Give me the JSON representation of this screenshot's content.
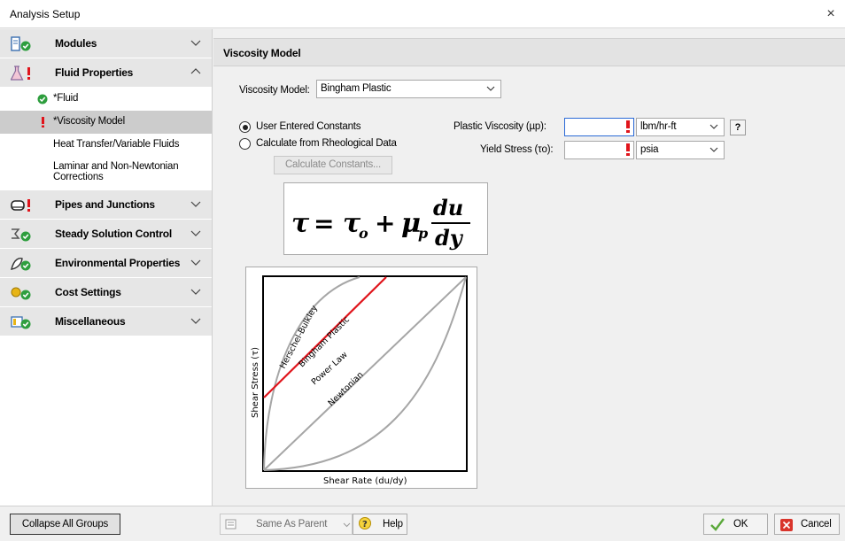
{
  "window": {
    "title": "Analysis Setup",
    "close_glyph": "×"
  },
  "sidebar": {
    "groups": [
      {
        "label": "Modules",
        "icon": "modules-icon",
        "status": "ok",
        "expanded": false
      },
      {
        "label": "Fluid Properties",
        "icon": "flask-icon",
        "status": "error",
        "expanded": true,
        "items": [
          {
            "label": "*Fluid",
            "status": "ok"
          },
          {
            "label": "*Viscosity Model",
            "status": "error",
            "selected": true
          },
          {
            "label": "Heat Transfer/Variable Fluids"
          },
          {
            "label": "Laminar and Non-Newtonian Corrections"
          }
        ]
      },
      {
        "label": "Pipes and Junctions",
        "icon": "pipes-icon",
        "status": "error",
        "expanded": false
      },
      {
        "label": "Steady Solution Control",
        "icon": "solution-control-icon",
        "status": "ok",
        "expanded": false
      },
      {
        "label": "Environmental Properties",
        "icon": "environment-icon",
        "status": "ok",
        "expanded": false
      },
      {
        "label": "Cost Settings",
        "icon": "cost-icon",
        "status": "ok",
        "expanded": false
      },
      {
        "label": "Miscellaneous",
        "icon": "miscellaneous-icon",
        "status": "ok",
        "expanded": false
      }
    ]
  },
  "panel": {
    "header": "Viscosity Model",
    "viscosity_model_label": "Viscosity Model:",
    "viscosity_model_value": "Bingham Plastic",
    "radio_user": "User Entered Constants",
    "radio_calc": "Calculate from Rheological Data",
    "calc_button": "Calculate Constants...",
    "plastic_viscosity_label": "Plastic Viscosity (µp):",
    "plastic_viscosity_value": "",
    "plastic_viscosity_unit": "lbm/hr-ft",
    "yield_stress_label": "Yield Stress (τo):",
    "yield_stress_value": "",
    "yield_stress_unit": "psia",
    "help_button": "?",
    "formula": {
      "tau": "τ",
      "eq": "=",
      "tau0": "τ",
      "sub_o": "o",
      "plus": "+",
      "mu": "μ",
      "sub_p": "p",
      "numerator": "du",
      "denominator": "dy"
    },
    "diagram": {
      "curves": [
        "Herschel-Bulkley",
        "Bingham Plastic",
        "Power Law",
        "Newtonian"
      ],
      "ylabel": "Shear Stress (τ)",
      "xlabel": "Shear Rate (du/dy)",
      "highlight_color": "#e0141b",
      "curve_color": "#a6a6a6"
    }
  },
  "footer": {
    "collapse_button": "Collapse All Groups",
    "same_as_parent": "Same As Parent",
    "help": "Help",
    "ok": "OK",
    "cancel": "Cancel"
  },
  "colors": {
    "ok_green": "#2e9e3e",
    "error_red": "#e0141b",
    "accent_blue": "#2b6ad6"
  }
}
